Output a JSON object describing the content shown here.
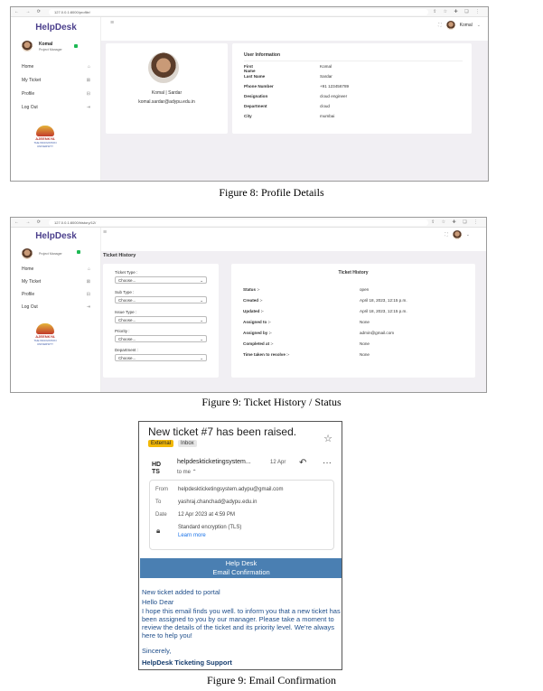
{
  "fig8": {
    "url": "127.0.0.1:8000/profile/",
    "brand": "HelpDesk",
    "user_name": "Komal",
    "user_role": "Project Manager",
    "menu": [
      {
        "label": "Home",
        "icon": "⌂"
      },
      {
        "label": "My Ticket",
        "icon": "⊠"
      },
      {
        "label": "Profile",
        "icon": "⊟"
      },
      {
        "label": "Log Out",
        "icon": "⇥"
      }
    ],
    "logo_name": "AJEENKYA",
    "logo_sub": "THE INNOVATION UNIVERSITY",
    "top_user": "Komal",
    "profile_name": "Komal | Sardar",
    "profile_email": "komal.sardar@adypu.edu.in",
    "info_title": "User Information",
    "info": [
      {
        "k": "First Name",
        "v": "Komal"
      },
      {
        "k": "Last Name",
        "v": "Sardar"
      },
      {
        "k": "Phone Number",
        "v": "+91 123456789"
      },
      {
        "k": "Designation",
        "v": "cloud engineer"
      },
      {
        "k": "Department",
        "v": "cloud"
      },
      {
        "k": "City",
        "v": "mumbai"
      }
    ],
    "caption": "Figure 8: Profile Details"
  },
  "fig9": {
    "url": "127.0.0.1:8000/history/12/",
    "brand": "HelpDesk",
    "user_role": "Project Manager",
    "menu": [
      {
        "label": "Home",
        "icon": "⌂"
      },
      {
        "label": "My Ticket",
        "icon": "⊠"
      },
      {
        "label": "Profile",
        "icon": "⊟"
      },
      {
        "label": "Log Out",
        "icon": "⇥"
      }
    ],
    "logo_name": "AJEENKYA",
    "logo_sub": "THE INNOVATION UNIVERSITY",
    "page_title": "Ticket History",
    "filters": [
      {
        "label": "Ticket Type :",
        "value": "Choose..."
      },
      {
        "label": "Sub Type :",
        "value": "Choose..."
      },
      {
        "label": "Issue Type :",
        "value": "Choose..."
      },
      {
        "label": "Priority :",
        "value": "Choose..."
      },
      {
        "label": "Department :",
        "value": "Choose..."
      }
    ],
    "history_title": "Ticket History",
    "history": [
      {
        "k": "Status :-",
        "v": "open"
      },
      {
        "k": "Created :-",
        "v": "April 18, 2023, 12:15 p.m."
      },
      {
        "k": "Updated :-",
        "v": "April 18, 2023, 12:15 p.m."
      },
      {
        "k": "Assigned to :-",
        "v": "None"
      },
      {
        "k": "Assigned by :-",
        "v": "admin@gmail.com"
      },
      {
        "k": "Completed at :-",
        "v": "None"
      },
      {
        "k": "Time taken to resolve :-",
        "v": "None"
      }
    ],
    "caption": "Figure 9: Ticket History / Status"
  },
  "email": {
    "subject": "New ticket #7 has been raised.",
    "badge_external": "External",
    "badge_inbox": "Inbox",
    "sender_avatar_top": "HD",
    "sender_avatar_bottom": "TS",
    "sender": "helpdeskticketingsystem...",
    "sent_date": "12 Apr",
    "to_me": "to me ⌃",
    "from_label": "From",
    "from_value": "helpdeskticketingsystem.adypu@gmail.com",
    "to_label": "To",
    "to_value": "yashraj.chanchad@adypu.edu.in",
    "date_label": "Date",
    "date_value": "12 Apr 2023 at 4:59 PM",
    "encryption": "Standard encryption (TLS)",
    "learn_more": "Learn more",
    "banner_line1": "Help Desk",
    "banner_line2": "Email Confirmation",
    "line1": "New ticket added to portal",
    "line2": "Hello Dear",
    "paragraph": "I hope this email finds you well. to inform you that a new ticket has been assigned to you by our manager. Please take a moment to review the details of the ticket and its priority level. We're always here to help you!",
    "sincerely": "Sincerely,",
    "signature": "HelpDesk Ticketing Support",
    "caption": "Figure 9: Email Confirmation"
  }
}
